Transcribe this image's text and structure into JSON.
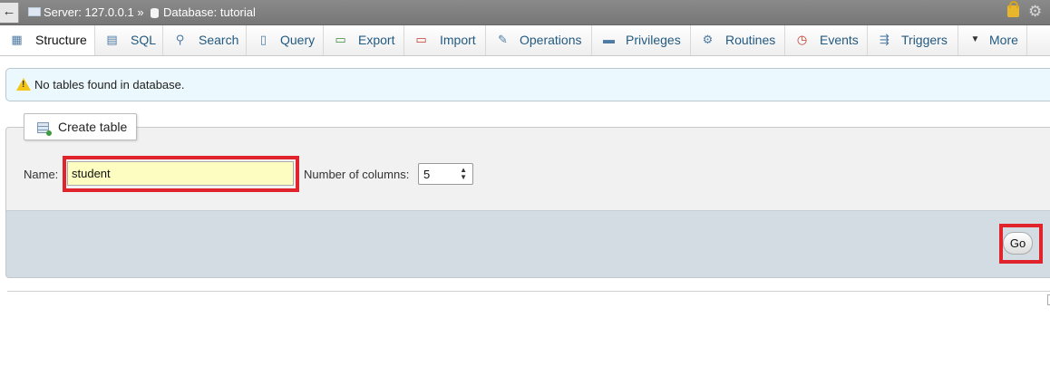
{
  "breadcrumb": {
    "server": "Server: 127.0.0.1 »",
    "database": "Database: tutorial"
  },
  "tabs": [
    {
      "label": "Structure",
      "icon": "structure-icon"
    },
    {
      "label": "SQL",
      "icon": "sql-icon"
    },
    {
      "label": "Search",
      "icon": "search-icon"
    },
    {
      "label": "Query",
      "icon": "query-icon"
    },
    {
      "label": "Export",
      "icon": "export-icon"
    },
    {
      "label": "Import",
      "icon": "import-icon"
    },
    {
      "label": "Operations",
      "icon": "wrench-icon"
    },
    {
      "label": "Privileges",
      "icon": "privileges-icon"
    },
    {
      "label": "Routines",
      "icon": "routines-icon"
    },
    {
      "label": "Events",
      "icon": "clock-icon"
    },
    {
      "label": "Triggers",
      "icon": "triggers-icon"
    },
    {
      "label": "More",
      "icon": "caret-down-icon"
    }
  ],
  "notice": {
    "message": "No tables found in database."
  },
  "create_table": {
    "legend": "Create table",
    "name_label": "Name:",
    "name_value": "student",
    "columns_label": "Number of columns:",
    "columns_value": "5",
    "go_label": "Go"
  },
  "colors": {
    "highlight": "#e1232b",
    "name_input_bg": "#fdfdc2",
    "link": "#235a81"
  }
}
